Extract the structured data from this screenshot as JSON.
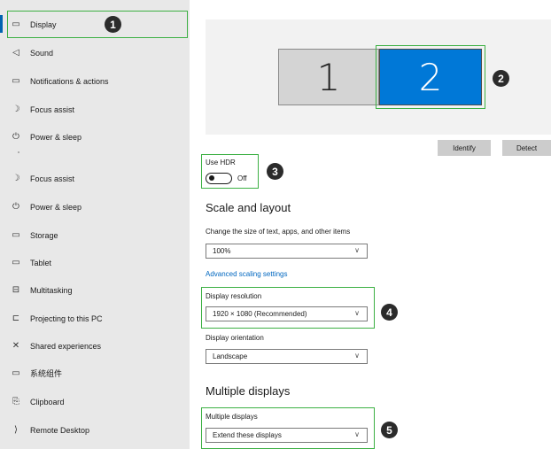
{
  "sidebar": {
    "items": [
      {
        "icon": "monitor-icon",
        "glyph": "▭",
        "label": "Display"
      },
      {
        "icon": "speaker-icon",
        "glyph": "◁",
        "label": "Sound"
      },
      {
        "icon": "notification-icon",
        "glyph": "▭",
        "label": "Notifications & actions"
      },
      {
        "icon": "moon-icon",
        "glyph": "☽",
        "label": "Focus assist"
      },
      {
        "icon": "power-icon",
        "glyph": "⏻",
        "label": "Power & sleep"
      },
      {
        "icon": "moon-icon",
        "glyph": "☽",
        "label": "Focus assist"
      },
      {
        "icon": "power-icon",
        "glyph": "⏻",
        "label": "Power & sleep"
      },
      {
        "icon": "storage-icon",
        "glyph": "▭",
        "label": "Storage"
      },
      {
        "icon": "tablet-icon",
        "glyph": "▭",
        "label": "Tablet"
      },
      {
        "icon": "multitasking-icon",
        "glyph": "⊟",
        "label": "Multitasking"
      },
      {
        "icon": "projector-icon",
        "glyph": "⊏",
        "label": "Projecting to this PC"
      },
      {
        "icon": "shared-experiences-icon",
        "glyph": "✕",
        "label": "Shared experiences"
      },
      {
        "icon": "system-components-icon",
        "glyph": "▭",
        "label": "系统组件"
      },
      {
        "icon": "clipboard-icon",
        "glyph": "⎘",
        "label": "Clipboard"
      },
      {
        "icon": "remote-desktop-icon",
        "glyph": "⟩",
        "label": "Remote Desktop"
      }
    ]
  },
  "badges": [
    "1",
    "2",
    "3",
    "4",
    "5"
  ],
  "monitors": {
    "one": "1",
    "two": "2"
  },
  "buttons": {
    "identify": "Identify",
    "detect": "Detect"
  },
  "hdr": {
    "label": "Use HDR",
    "state": "Off"
  },
  "scale_layout": {
    "heading": "Scale and layout",
    "scale_label": "Change the size of text, apps, and other items",
    "scale_value": "100%",
    "advanced_link": "Advanced scaling settings",
    "resolution_label": "Display resolution",
    "resolution_value": "1920 × 1080 (Recommended)",
    "orientation_label": "Display orientation",
    "orientation_value": "Landscape"
  },
  "multiple": {
    "heading": "Multiple displays",
    "label": "Multiple displays",
    "value": "Extend these displays"
  },
  "colors": {
    "accent": "#0078d7",
    "highlight": "#3cb043",
    "sidebar_bg": "#e8e8e8"
  }
}
